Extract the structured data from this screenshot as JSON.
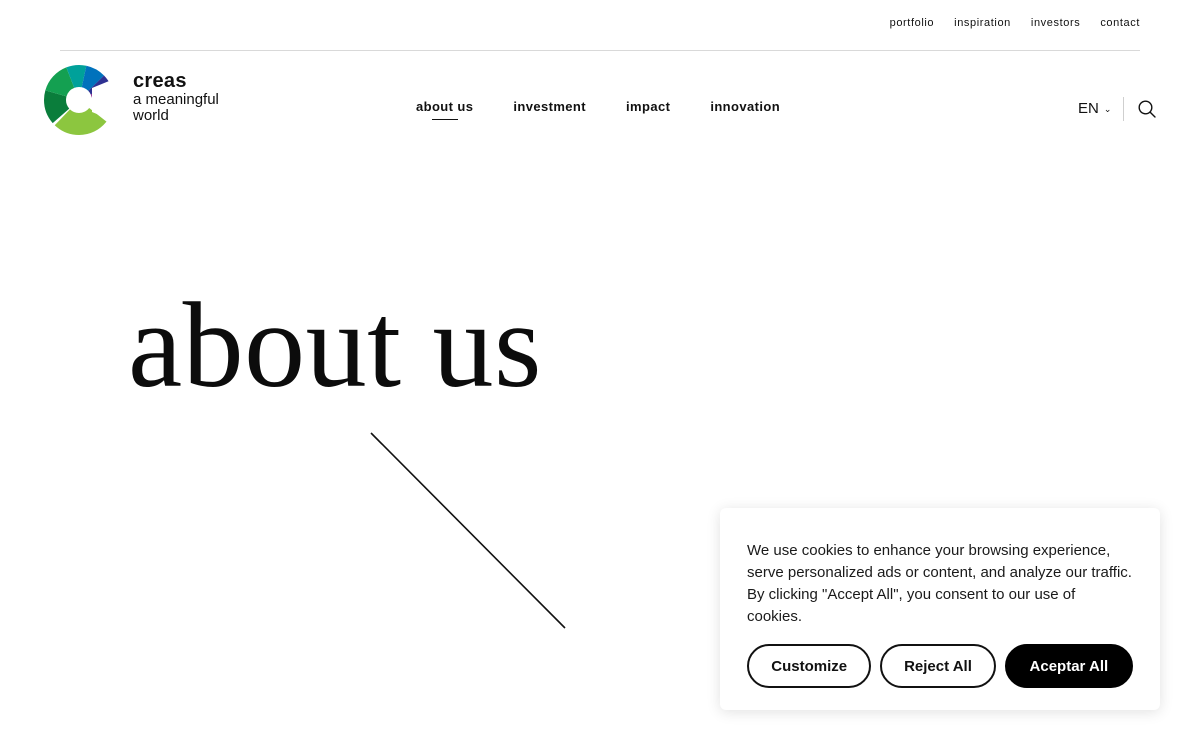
{
  "topnav": {
    "links": [
      "portfolio",
      "inspiration",
      "investors",
      "contact"
    ]
  },
  "logo": {
    "brand": "creas",
    "tagline": "a meaningful world",
    "colors": [
      "#0a7d3b",
      "#14a051",
      "#8cc63f",
      "#00a19a",
      "#0072bc",
      "#2e3192",
      "#92278f"
    ]
  },
  "mainnav": {
    "items": [
      "about us",
      "investment",
      "impact",
      "innovation"
    ],
    "active": "about us"
  },
  "header": {
    "language": "EN",
    "language_icon": "chevron-down-icon",
    "search_icon": "search-icon"
  },
  "hero": {
    "title": "about us"
  },
  "cookie_banner": {
    "text": "We use cookies to enhance your browsing experience, serve personalized ads or content, and analyze our traffic. By clicking \"Accept All\", you consent to our use of cookies.",
    "customize_label": "Customize",
    "reject_label": "Reject All",
    "accept_label": "Aceptar All"
  }
}
